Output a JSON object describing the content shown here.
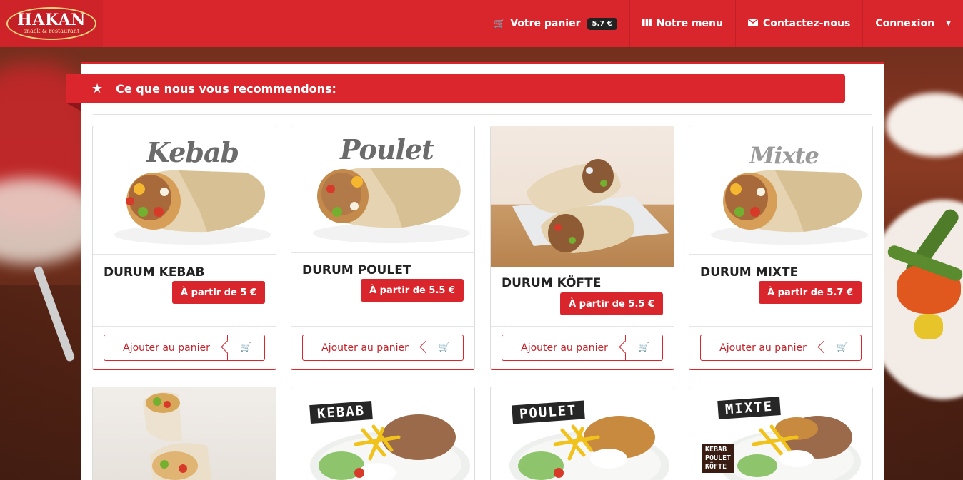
{
  "brand": {
    "name": "HAKAN",
    "tagline": "snack & restaurant"
  },
  "nav": {
    "cart_label": "Votre panier",
    "cart_total": "5.7 €",
    "menu_label": "Notre menu",
    "contact_label": "Contactez-nous",
    "login_label": "Connexion"
  },
  "section": {
    "heading": "Ce que nous vous recommendons:"
  },
  "add_to_cart_label": "Ajouter au panier",
  "products": [
    {
      "name": "DURUM KEBAB",
      "price": "À partir de 5 €",
      "image_word": "Kebab"
    },
    {
      "name": "DURUM POULET",
      "price": "À partir de 5.5 €",
      "image_word": "Poulet"
    },
    {
      "name": "DURUM KÖFTE",
      "price": "À partir de 5.5 €"
    },
    {
      "name": "DURUM MIXTE",
      "price": "À partir de 5.7 €",
      "image_word": "Mixte"
    }
  ],
  "plates": [
    {
      "image_word": "KEBAB"
    },
    {
      "image_word": "POULET"
    },
    {
      "image_word": "MIXTE",
      "sub_words": [
        "KEBAB",
        "POULET",
        "KÖFTE"
      ]
    }
  ],
  "icons": {
    "cart": "shopping-cart-icon",
    "menu": "grid-icon",
    "contact": "envelope-icon",
    "star": "star-icon"
  },
  "colors": {
    "brand_red": "#d9262d",
    "dark_badge": "#222222"
  }
}
